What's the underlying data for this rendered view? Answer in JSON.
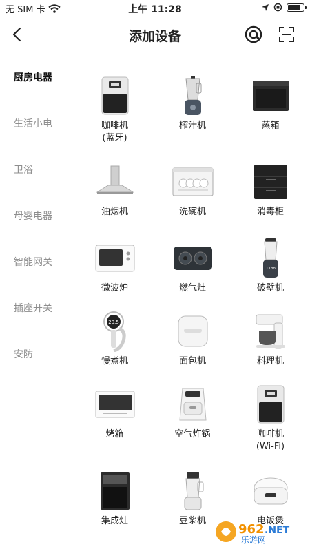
{
  "status_bar": {
    "carrier": "无 SIM 卡",
    "time": "上午 11:28",
    "battery_level": 0.85
  },
  "header": {
    "title": "添加设备",
    "back_icon": "back-chevron-icon",
    "right_icons": [
      "at-sign-icon",
      "scan-icon"
    ]
  },
  "sidebar": {
    "items": [
      {
        "label": "厨房电器",
        "active": true
      },
      {
        "label": "生活小电",
        "active": false
      },
      {
        "label": "卫浴",
        "active": false
      },
      {
        "label": "母婴电器",
        "active": false
      },
      {
        "label": "智能网关",
        "active": false
      },
      {
        "label": "插座开关",
        "active": false
      },
      {
        "label": "安防",
        "active": false
      }
    ]
  },
  "devices": [
    {
      "label": "咖啡机",
      "sub": "(蓝牙)",
      "icon": "coffee-machine-icon"
    },
    {
      "label": "榨汁机",
      "sub": "",
      "icon": "juicer-icon"
    },
    {
      "label": "蒸箱",
      "sub": "",
      "icon": "steam-oven-icon"
    },
    {
      "label": "油烟机",
      "sub": "",
      "icon": "range-hood-icon"
    },
    {
      "label": "洗碗机",
      "sub": "",
      "icon": "dishwasher-icon"
    },
    {
      "label": "消毒柜",
      "sub": "",
      "icon": "disinfection-cabinet-icon"
    },
    {
      "label": "微波炉",
      "sub": "",
      "icon": "microwave-icon"
    },
    {
      "label": "燃气灶",
      "sub": "",
      "icon": "gas-stove-icon"
    },
    {
      "label": "破壁机",
      "sub": "",
      "icon": "blender-icon"
    },
    {
      "label": "慢煮机",
      "sub": "",
      "icon": "sous-vide-icon"
    },
    {
      "label": "面包机",
      "sub": "",
      "icon": "bread-maker-icon"
    },
    {
      "label": "料理机",
      "sub": "",
      "icon": "food-processor-icon"
    },
    {
      "label": "烤箱",
      "sub": "",
      "icon": "oven-icon"
    },
    {
      "label": "空气炸锅",
      "sub": "",
      "icon": "air-fryer-icon"
    },
    {
      "label": "咖啡机",
      "sub": "(Wi-Fi)",
      "icon": "coffee-machine-wifi-icon"
    },
    {
      "label": "集成灶",
      "sub": "",
      "icon": "integrated-stove-icon"
    },
    {
      "label": "豆浆机",
      "sub": "",
      "icon": "soymilk-maker-icon"
    },
    {
      "label": "电饭煲",
      "sub": "",
      "icon": "rice-cooker-icon"
    }
  ],
  "device_readouts": {
    "slow_cooker_temp": "20.5",
    "blender_display": "1188"
  },
  "watermark": {
    "brand": "962",
    "domain": ".NET",
    "text": "乐游网"
  }
}
